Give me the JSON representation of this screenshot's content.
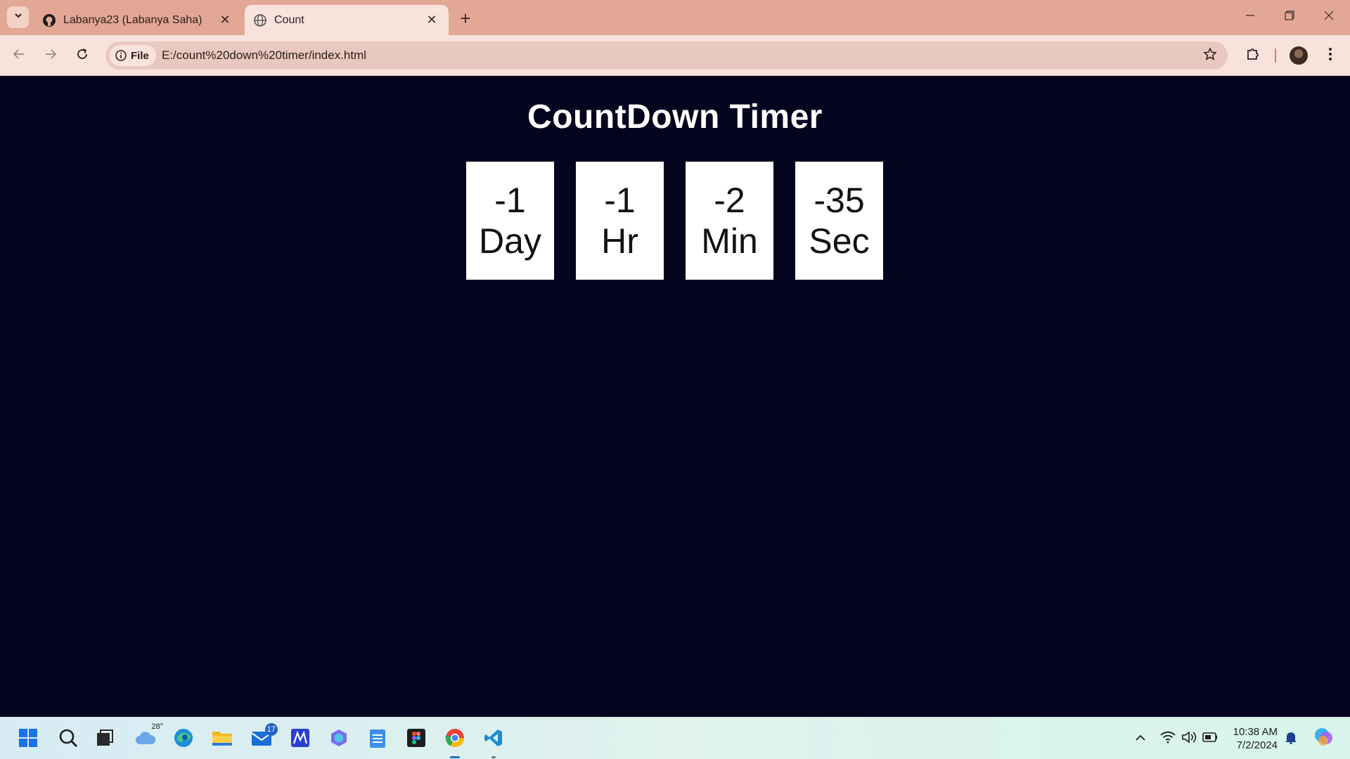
{
  "browser": {
    "tabs": [
      {
        "title": "Labanya23 (Labanya Saha)",
        "icon": "github-icon",
        "active": false
      },
      {
        "title": "Count",
        "icon": "globe-icon",
        "active": true
      }
    ],
    "chip_label": "File",
    "url": "E:/count%20down%20timer/index.html"
  },
  "page": {
    "title": "CountDown Timer",
    "units": [
      {
        "value": "-1",
        "label": "Day"
      },
      {
        "value": "-1",
        "label": "Hr"
      },
      {
        "value": "-2",
        "label": "Min"
      },
      {
        "value": "-35",
        "label": "Sec"
      }
    ]
  },
  "taskbar": {
    "weather_temp": "28°",
    "mail_badge": "17",
    "time": "10:38 AM",
    "date": "7/2/2024"
  },
  "colors": {
    "page_background": "#05041f",
    "box_background": "#ffffff",
    "tab_strip": "#e3a796",
    "toolbar": "#f7e3dc"
  }
}
